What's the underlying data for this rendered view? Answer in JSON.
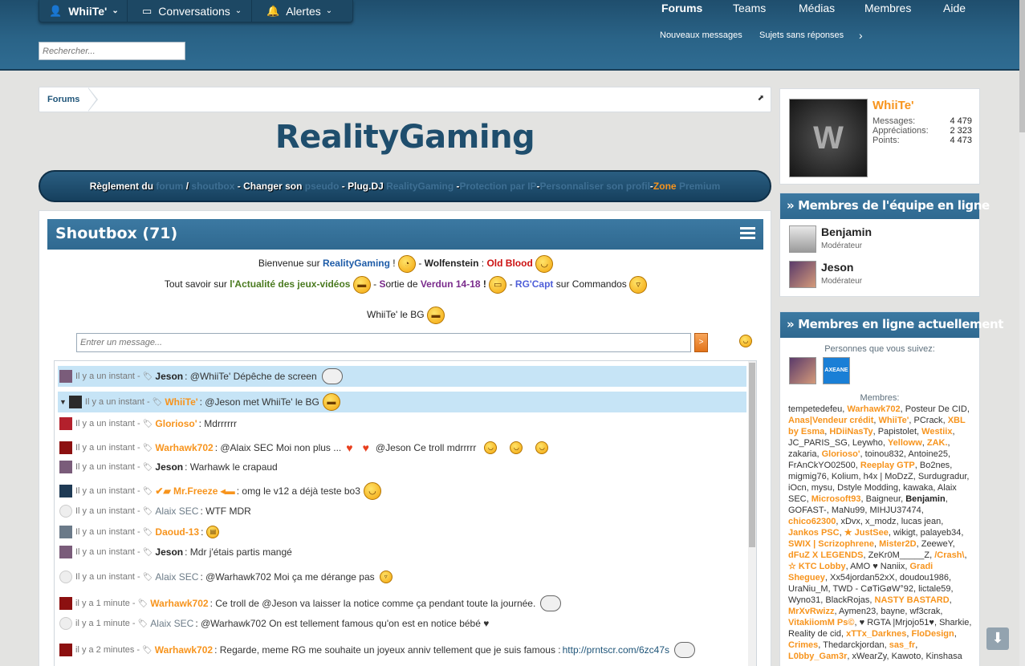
{
  "header": {
    "user_menu": "WhiiTe'",
    "conversations": "Conversations",
    "alerts": "Alertes",
    "search_placeholder": "Rechercher...",
    "nav": [
      "Forums",
      "Teams",
      "Médias",
      "Membres",
      "Aide"
    ],
    "subnav": [
      "Nouveaux messages",
      "Sujets sans réponses"
    ]
  },
  "breadcrumb": {
    "item": "Forums"
  },
  "site_title": "RealityGaming",
  "rules_bar": {
    "p1": "Règlement du",
    "p2": "forum",
    "p3": "/",
    "p4": "shoutbox",
    "p5": "- Changer son",
    "p6": "pseudo",
    "p7": "- Plug.DJ",
    "p8": "RealityGaming",
    "p9": "- ",
    "p10": "Protection par IP",
    "p11": " - ",
    "p12": "Personnaliser son profil",
    "p13": " - ",
    "p14": "Zone",
    "p15": "Premium"
  },
  "shoutbox": {
    "title": "Shoutbox (71)",
    "announce1": {
      "a": "Bienvenue sur ",
      "b": "RealityGaming",
      "c": " ! ",
      "d": " - ",
      "e": "Wolfenstein",
      "f": " : ",
      "g": "Old Blood"
    },
    "announce2": {
      "a": "Tout savoir sur ",
      "b": "l'Actualité des jeux-vidéos",
      "c": " - ",
      "d": "S",
      "e": "ortie de ",
      "f": "Verdun ",
      "g": "14-18",
      "h": " ! ",
      "i": " - ",
      "j": "RG'Capt",
      "k": " sur Commandos"
    },
    "announce3": "WhiiTe' le BG",
    "input_placeholder": "Entrer un message...",
    "send_label": ">",
    "messages": [
      {
        "time": "Il y a un instant -",
        "user": "Jeson",
        "text": ": @WhiiTe' Dépêche de screen"
      },
      {
        "time": "Il y a un instant -",
        "user": "WhiiTe'",
        "text": ": @Jeson met WhiiTe' le BG"
      },
      {
        "time": "Il y a un instant -",
        "user": "Glorioso'",
        "text": ": Mdrrrrrr"
      },
      {
        "time": "Il y a un instant -",
        "user": "Warhawk702",
        "text": ": @Alaix SEC Moi non plus ...",
        "text2": "@Jeson Ce troll mdrrrrr"
      },
      {
        "time": "Il y a un instant -",
        "user": "Jeson",
        "text": ": Warhawk le crapaud"
      },
      {
        "time": "Il y a un instant -",
        "user": "✔▰ Mr.Freeze ◂▬",
        "text": ": omg le v12 a déjà teste bo3"
      },
      {
        "time": "Il y a un instant -",
        "user": "Alaix SEC",
        "text": ": WTF MDR"
      },
      {
        "time": "Il y a un instant -",
        "user": "Daoud-13",
        "text": ":"
      },
      {
        "time": "Il y a un instant -",
        "user": "Jeson",
        "text": ": Mdr j'étais partis mangé"
      },
      {
        "time": "Il y a un instant -",
        "user": "Alaix SEC",
        "text": ": @Warhawk702 Moi ça me dérange pas"
      },
      {
        "time": "il y a 1 minute -",
        "user": "Warhawk702",
        "text": ": Ce troll de @Jeson va laisser la notice comme ça pendant toute la journée."
      },
      {
        "time": "il y a 1 minute -",
        "user": "Alaix SEC",
        "text": ": @Warhawk702 On est tellement famous qu'on est en notice bébé ♥"
      },
      {
        "time": "il y a 2 minutes -",
        "user": "Warhawk702",
        "text": ": Regarde, meme RG me souhaite un joyeux anniv tellement que je suis famous : ",
        "link": "http://prntscr.com/6zc47s"
      }
    ]
  },
  "visitor": {
    "name": "WhiiTe'",
    "messages_label": "Messages:",
    "messages_value": "4 479",
    "likes_label": "Appréciations:",
    "likes_value": "2 323",
    "points_label": "Points:",
    "points_value": "4 473"
  },
  "staff": {
    "title": "Membres de l'équipe en ligne",
    "members": [
      {
        "name": "Benjamin",
        "role": "Modérateur"
      },
      {
        "name": "Jeson",
        "role": "Modérateur"
      }
    ]
  },
  "online": {
    "title": "Membres en ligne actuellement",
    "following_label": "Personnes que vous suivez:",
    "members_label": "Membres:",
    "follow_badge": "AXEANE",
    "members": [
      {
        "n": "tempetedefeu",
        "s": ""
      },
      {
        "n": "Warhawk702",
        "s": "o"
      },
      {
        "n": "Posteur De CID",
        "s": ""
      },
      {
        "n": "Anas|Vendeur crédit",
        "s": "o"
      },
      {
        "n": "WhiiTe'",
        "s": "o"
      },
      {
        "n": "PCrack",
        "s": ""
      },
      {
        "n": "XBL by Esma",
        "s": "o"
      },
      {
        "n": "HDiiNasTy",
        "s": "o"
      },
      {
        "n": "Papistolet",
        "s": ""
      },
      {
        "n": "Westiix",
        "s": "o"
      },
      {
        "n": "JC_PARIS_SG",
        "s": ""
      },
      {
        "n": "Leywho",
        "s": ""
      },
      {
        "n": "Yelloww",
        "s": "o"
      },
      {
        "n": "ZAK.",
        "s": "o"
      },
      {
        "n": "zakaria",
        "s": ""
      },
      {
        "n": "Glorioso'",
        "s": "o"
      },
      {
        "n": "toinou832",
        "s": ""
      },
      {
        "n": "Antoine25",
        "s": ""
      },
      {
        "n": "FrAnCkYO02500",
        "s": ""
      },
      {
        "n": "Reeplay GTP",
        "s": "o"
      },
      {
        "n": "Bo2nes",
        "s": ""
      },
      {
        "n": "migmig76",
        "s": ""
      },
      {
        "n": "Kolium",
        "s": ""
      },
      {
        "n": "h4x | MoDzZ",
        "s": ""
      },
      {
        "n": "Surdugradur",
        "s": ""
      },
      {
        "n": "iOcn",
        "s": ""
      },
      {
        "n": "mysu",
        "s": ""
      },
      {
        "n": "Dstyle Modding",
        "s": ""
      },
      {
        "n": "kawaka",
        "s": ""
      },
      {
        "n": "Alaix SEC",
        "s": ""
      },
      {
        "n": "Microsoft93",
        "s": "o"
      },
      {
        "n": "Baigneur",
        "s": ""
      },
      {
        "n": "Benjamin",
        "s": "b"
      },
      {
        "n": "GOFAST-",
        "s": ""
      },
      {
        "n": "MaNu99",
        "s": ""
      },
      {
        "n": "MIHJU37474",
        "s": ""
      },
      {
        "n": "chico62300",
        "s": "o"
      },
      {
        "n": "xDvx",
        "s": ""
      },
      {
        "n": "x_modz",
        "s": ""
      },
      {
        "n": "lucas jean",
        "s": ""
      },
      {
        "n": "Jankos PSC",
        "s": "o"
      },
      {
        "n": "★ JustSee",
        "s": "o"
      },
      {
        "n": "wikigt",
        "s": ""
      },
      {
        "n": "palayeb34",
        "s": ""
      },
      {
        "n": "SWIX | Scrizophrene",
        "s": "o"
      },
      {
        "n": "Mister2D",
        "s": "o"
      },
      {
        "n": "ZeeweY",
        "s": ""
      },
      {
        "n": "dFuZ X LEGENDS",
        "s": "o"
      },
      {
        "n": "ZeKr0M_____Z",
        "s": ""
      },
      {
        "n": "/Crash\\",
        "s": "o"
      },
      {
        "n": "☆ KTC Lobby",
        "s": "o"
      },
      {
        "n": "AMO ♥ Naniix",
        "s": ""
      },
      {
        "n": "Gradi Sheguey",
        "s": "o"
      },
      {
        "n": "Xx54jordan52xX",
        "s": ""
      },
      {
        "n": "doudou1986",
        "s": ""
      },
      {
        "n": "UraNiu_M",
        "s": ""
      },
      {
        "n": "TWD - CøTiGøW°92",
        "s": ""
      },
      {
        "n": "lictale59",
        "s": ""
      },
      {
        "n": "Wyno31",
        "s": ""
      },
      {
        "n": "BlackRojas",
        "s": ""
      },
      {
        "n": "NASTY BASTARD",
        "s": "o"
      },
      {
        "n": "MrXvRwizz",
        "s": "o"
      },
      {
        "n": "Aymen23",
        "s": ""
      },
      {
        "n": "bayne",
        "s": ""
      },
      {
        "n": "wf3crak",
        "s": ""
      },
      {
        "n": "VitakiiomM Ps©",
        "s": "o"
      },
      {
        "n": "♥ RGTA |Mrjojo51♥",
        "s": ""
      },
      {
        "n": "Sharkie",
        "s": ""
      },
      {
        "n": "Reality de cid",
        "s": ""
      },
      {
        "n": "xTTx_Darknes",
        "s": "o"
      },
      {
        "n": "FloDesign",
        "s": "o"
      },
      {
        "n": "Crimes",
        "s": "o"
      },
      {
        "n": "Thedarckjordan",
        "s": ""
      },
      {
        "n": "sas_fr",
        "s": "o"
      },
      {
        "n": "L0bby_Gam3r",
        "s": "o"
      },
      {
        "n": "xWearZy",
        "s": ""
      },
      {
        "n": "Kawoto",
        "s": ""
      },
      {
        "n": "Kinshasa",
        "s": ""
      }
    ]
  },
  "colors": {
    "accent": "#f7941d",
    "brand": "#1f4e6d",
    "highlight": "#c6e4f6"
  }
}
